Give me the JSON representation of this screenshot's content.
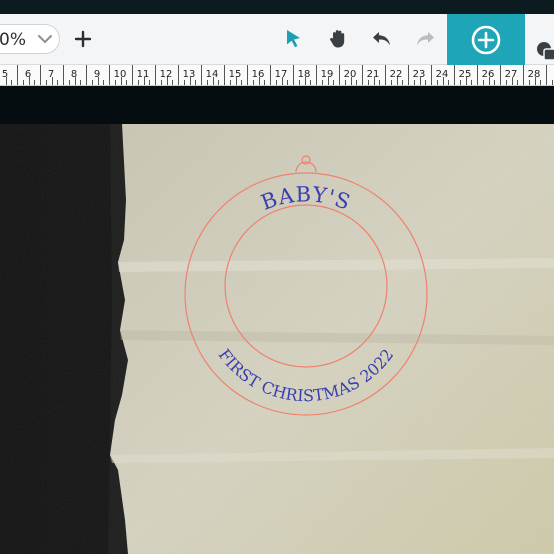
{
  "toolbar": {
    "zoom_value": "0%",
    "zoom_dropdown_icon": "chevron-down-icon",
    "add_icon": "plus-icon",
    "tools": [
      {
        "name": "select-pointer-icon",
        "color": "#1c9fb3"
      },
      {
        "name": "pan-hand-icon",
        "color": "#3a3f44"
      },
      {
        "name": "undo-icon",
        "color": "#3a3f44"
      },
      {
        "name": "redo-icon",
        "color": "#b9bdc1"
      }
    ],
    "add_shape_icon": "plus-circle-icon",
    "add_shape_color": "#1ea5b8",
    "layers_icon": "layers-icon"
  },
  "ruler": {
    "labels": [
      "5",
      "6",
      "7",
      "8",
      "9",
      "10",
      "11",
      "12",
      "13",
      "14",
      "15",
      "16",
      "17",
      "18",
      "19",
      "20",
      "21",
      "22",
      "23",
      "24",
      "25",
      "26",
      "27",
      "28"
    ]
  },
  "canvas": {
    "ornament": {
      "text_top": "BABY'S",
      "text_bottom": "FIRST CHRISTMAS 2022",
      "cut_line_color": "#f08070",
      "text_color": "#3a3fb0"
    }
  }
}
